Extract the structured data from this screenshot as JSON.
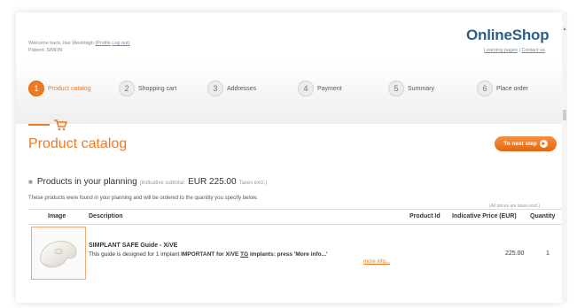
{
  "header": {
    "welcome_prefix": "Welcome back,",
    "user_name": "Ilse Westdagh",
    "profile_link": "(Profile",
    "logout_link": "Log out)",
    "patient_label": "Patient:",
    "patient_name": "SIMON",
    "logo": "OnlineShop",
    "link_learning": "Learning pages",
    "link_sep": " | ",
    "link_contact": "Contact us"
  },
  "steps": [
    {
      "num": "1",
      "label": "Product catalog",
      "active": true
    },
    {
      "num": "2",
      "label": "Shopping cart",
      "active": false
    },
    {
      "num": "3",
      "label": "Addresses",
      "active": false
    },
    {
      "num": "4",
      "label": "Payment",
      "active": false
    },
    {
      "num": "5",
      "label": "Summary",
      "active": false
    },
    {
      "num": "6",
      "label": "Place order",
      "active": false
    }
  ],
  "main": {
    "title": "Product catalog",
    "next_button": "To next step",
    "products_heading": "Products in your planning",
    "subtotal_label": "(indicative subtotal:",
    "subtotal_amount": "EUR 225.00",
    "subtotal_tax": "Taxes excl.)",
    "description": "These products were found in your planning and will be ordered to the quantity you specify below.",
    "price_note": "(All prices are taxes excl.)"
  },
  "table": {
    "headers": {
      "image": "Image",
      "description": "Description",
      "product_id": "Product Id",
      "price": "Indicative Price (EUR)",
      "quantity": "Quantity"
    },
    "rows": [
      {
        "name": "SIMPLANT SAFE Guide - XiVE",
        "desc_start": "This guide is designed for 1 implant",
        "desc_bold": "IMPORTANT for XiVE",
        "desc_tg": "TG",
        "desc_end": "implants: press 'More info...'",
        "more_link": "more info...",
        "product_id": "",
        "price": "225.00",
        "quantity": "1"
      }
    ]
  },
  "colors": {
    "accent": "#ee7a22",
    "logo": "#2f5f86",
    "link": "#6a8fb0"
  }
}
